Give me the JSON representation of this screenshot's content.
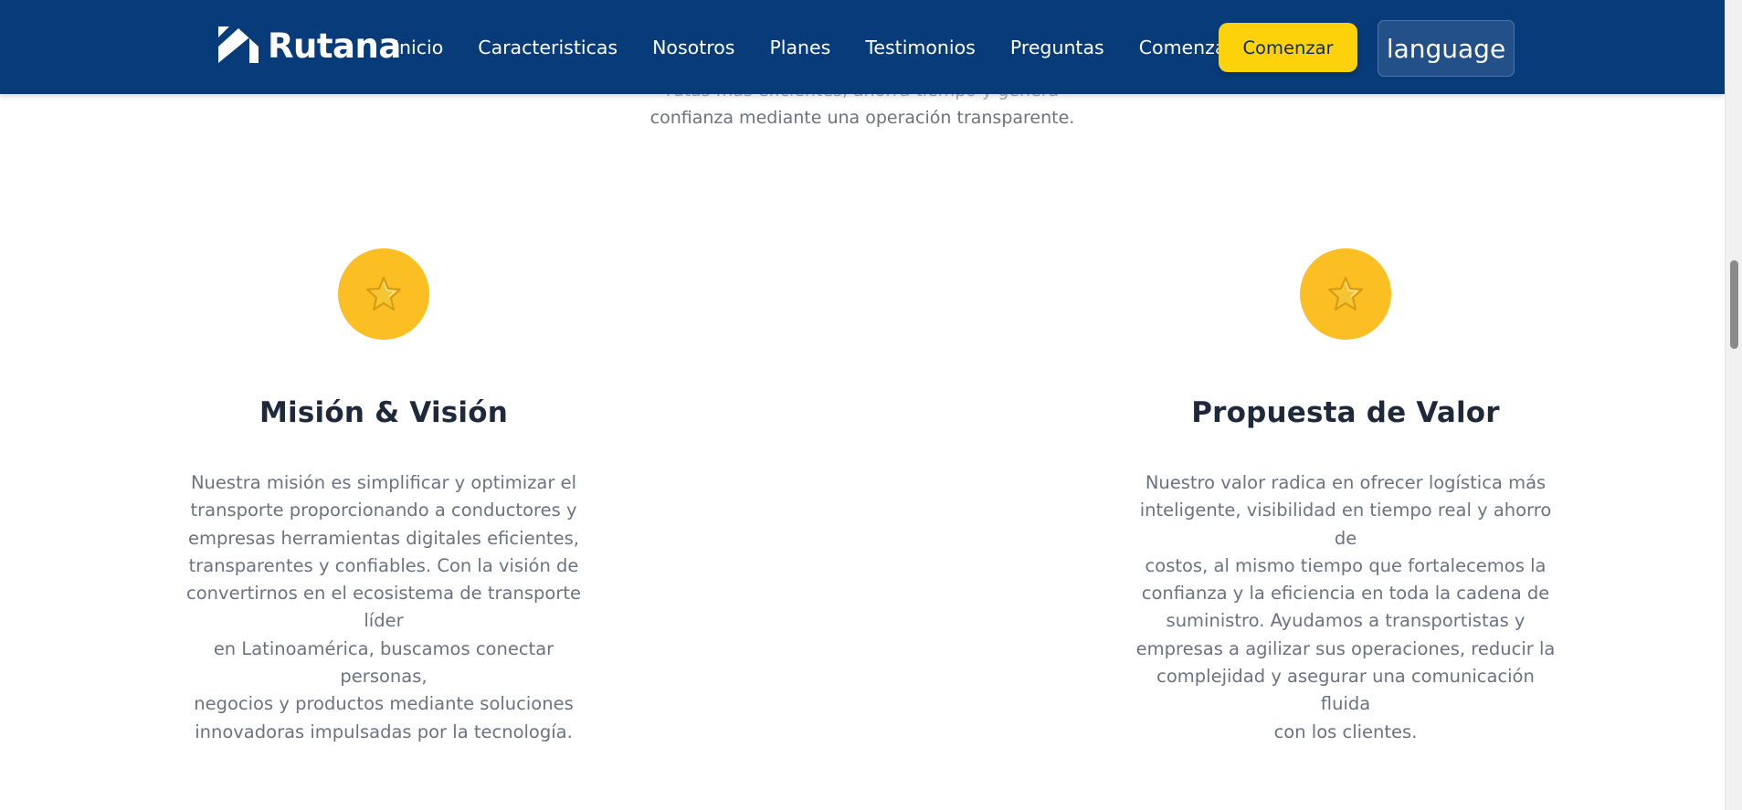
{
  "header": {
    "brand": "Rutana",
    "nav": [
      "Inicio",
      "Caracteristicas",
      "Nosotros",
      "Planes",
      "Testimonios",
      "Preguntas",
      "Comenzar"
    ],
    "cta_label": "Comenzar",
    "language_label": "language",
    "colors": {
      "background": "#073b7a",
      "cta": "#fdd20b"
    }
  },
  "intro": {
    "line_clipped": "rutas más eficientes, ahorra tiempo y genera",
    "line_visible": "confianza mediante una operación transparente."
  },
  "cards": [
    {
      "icon": "star-icon",
      "title": "Misión & Visión",
      "lines": [
        "Nuestra misión es simplificar y optimizar el",
        "transporte proporcionando a conductores y",
        "empresas herramientas digitales eficientes,",
        "transparentes y confiables. Con la visión de",
        "convertirnos en el ecosistema de transporte líder",
        "en Latinoamérica, buscamos conectar personas,",
        "negocios y productos mediante soluciones",
        "innovadoras impulsadas por la tecnología."
      ]
    },
    {
      "icon": "star-icon",
      "title": "Propuesta de Valor",
      "lines": [
        "Nuestro valor radica en ofrecer logística más",
        "inteligente, visibilidad en tiempo real y ahorro de",
        "costos, al mismo tiempo que fortalecemos la",
        "confianza y la eficiencia en toda la cadena de",
        "suministro. Ayudamos a transportistas y",
        "empresas a agilizar sus operaciones, reducir la",
        "complejidad y asegurar una comunicación fluida",
        "con los clientes."
      ]
    }
  ],
  "colors": {
    "icon_circle": "#fbbf24",
    "star": "#f5c533"
  }
}
